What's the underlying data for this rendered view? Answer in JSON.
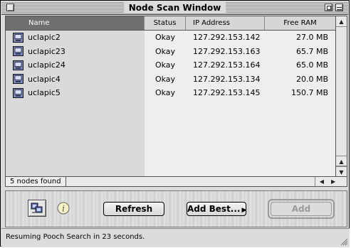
{
  "window": {
    "title": "Node Scan Window"
  },
  "columns": {
    "name": "Name",
    "status": "Status",
    "ip": "IP Address",
    "ram": "Free RAM"
  },
  "rows": [
    {
      "name": "uclapic2",
      "status": "Okay",
      "ip": "127.292.153.142",
      "ram": "27.0 MB"
    },
    {
      "name": "uclapic23",
      "status": "Okay",
      "ip": "127.292.153.163",
      "ram": "65.7 MB"
    },
    {
      "name": "uclapic24",
      "status": "Okay",
      "ip": "127.292.153.164",
      "ram": "65.0 MB"
    },
    {
      "name": "uclapic4",
      "status": "Okay",
      "ip": "127.292.153.134",
      "ram": "20.0 MB"
    },
    {
      "name": "uclapic5",
      "status": "Okay",
      "ip": "127.292.153.145",
      "ram": "150.7 MB"
    }
  ],
  "list_status": {
    "count": "5 nodes found"
  },
  "buttons": {
    "refresh": "Refresh",
    "add_best": "Add Best...",
    "add": "Add"
  },
  "icons": {
    "network": "network-nodes-icon",
    "info": "info-icon",
    "node": "node-computer-icon"
  },
  "footer": {
    "message": "Resuming Pooch Search in 23 seconds."
  },
  "colors": {
    "selected_header": "#6f6f6f",
    "name_column_bg": "#dadada",
    "disabled_text": "#9a9a9a"
  }
}
